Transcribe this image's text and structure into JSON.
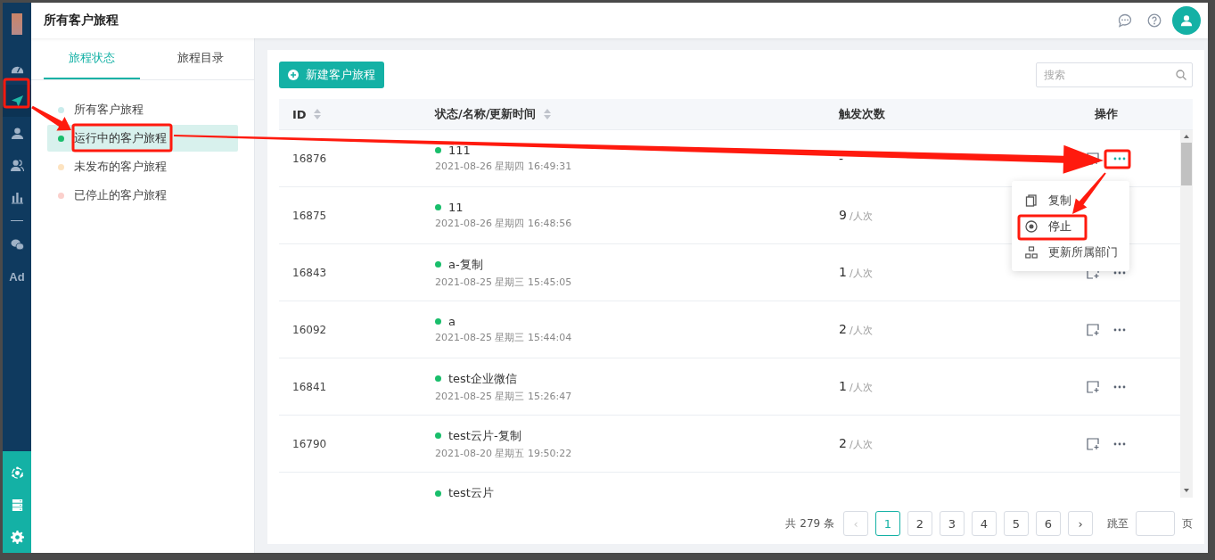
{
  "rail": {
    "items": [
      {
        "kind": "dashboard",
        "selected": false
      },
      {
        "kind": "send",
        "selected": true
      },
      {
        "kind": "user",
        "selected": false
      },
      {
        "kind": "users",
        "selected": false
      },
      {
        "kind": "chart",
        "selected": false
      },
      {
        "kind": "divider"
      },
      {
        "kind": "wechat",
        "selected": false
      },
      {
        "kind": "text",
        "label": "Ad",
        "selected": false
      }
    ],
    "bottom_items": [
      {
        "kind": "network"
      },
      {
        "kind": "server"
      },
      {
        "kind": "settings"
      }
    ]
  },
  "header": {
    "title": "所有客户旅程"
  },
  "side_panel": {
    "tabs": [
      {
        "label": "旅程状态",
        "selected": true
      },
      {
        "label": "旅程目录",
        "selected": false
      }
    ],
    "items": [
      {
        "label": "所有客户旅程",
        "color": "#c9ecec",
        "selected": false
      },
      {
        "label": "运行中的客户旅程",
        "color": "#19be6b",
        "selected": true
      },
      {
        "label": "未发布的客户旅程",
        "color": "#fde3c0",
        "selected": false
      },
      {
        "label": "已停止的客户旅程",
        "color": "#fbd0cc",
        "selected": false
      }
    ]
  },
  "toolbar": {
    "new_button": "新建客户旅程",
    "search": {
      "placeholder": "搜索"
    }
  },
  "table": {
    "columns": [
      {
        "label": "ID",
        "sortable": true
      },
      {
        "label": "状态/名称/更新时间",
        "sortable": true
      },
      {
        "label": "触发次数",
        "sortable": false
      },
      {
        "label": "操作",
        "sortable": false
      }
    ],
    "rows": [
      {
        "id": "16876",
        "name": "111",
        "time": "2021-08-26 星期四 16:49:31",
        "count": "-",
        "color": "#19be6b",
        "actions": true,
        "menu_open": true
      },
      {
        "id": "16875",
        "name": "11",
        "time": "2021-08-26 星期四 16:48:56",
        "count": "9",
        "unit": "/人次",
        "color": "#19be6b",
        "actions": false
      },
      {
        "id": "16843",
        "name": "a-复制",
        "time": "2021-08-25 星期三 15:45:05",
        "count": "1",
        "unit": "/人次",
        "color": "#19be6b",
        "actions": true
      },
      {
        "id": "16092",
        "name": "a",
        "time": "2021-08-25 星期三 15:44:04",
        "count": "2",
        "unit": "/人次",
        "color": "#19be6b",
        "actions": true
      },
      {
        "id": "16841",
        "name": "test企业微信",
        "time": "2021-08-25 星期三 15:26:47",
        "count": "1",
        "unit": "/人次",
        "color": "#19be6b",
        "actions": true
      },
      {
        "id": "16790",
        "name": "test云片-复制",
        "time": "2021-08-20 星期五 19:50:22",
        "count": "2",
        "unit": "/人次",
        "color": "#19be6b",
        "actions": true
      },
      {
        "name": "test云片",
        "color": "#19be6b"
      }
    ]
  },
  "menu": {
    "items": [
      {
        "kind": "copy",
        "label": "复制",
        "selected": false
      },
      {
        "kind": "stop",
        "label": "停止",
        "selected": true
      },
      {
        "kind": "org",
        "label": "更新所属部门",
        "selected": false
      }
    ]
  },
  "pagination": {
    "total": "共 279 条",
    "prev": "‹",
    "next": "›",
    "pages": [
      {
        "label": "1",
        "selected": true
      },
      {
        "label": "2",
        "selected": false
      },
      {
        "label": "3",
        "selected": false
      },
      {
        "label": "4",
        "selected": false
      },
      {
        "label": "5",
        "selected": false
      },
      {
        "label": "6",
        "selected": false
      }
    ],
    "jump_label": "跳至",
    "page_unit": "页"
  }
}
